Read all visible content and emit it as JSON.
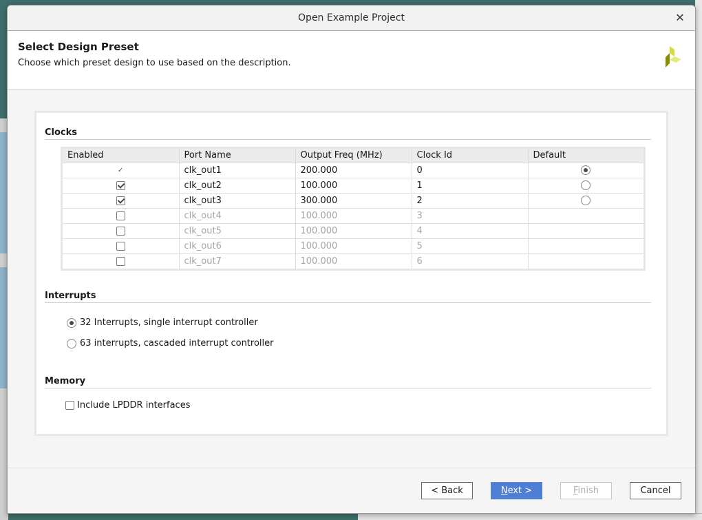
{
  "window": {
    "title": "Open Example Project"
  },
  "header": {
    "title": "Select Design Preset",
    "subtitle": "Choose which preset design to use based on the description."
  },
  "clocks": {
    "section_label": "Clocks",
    "columns": [
      "Enabled",
      "Port Name",
      "Output Freq (MHz)",
      "Clock Id",
      "Default"
    ],
    "rows": [
      {
        "enabled": "locked-checked",
        "port": "clk_out1",
        "freq": "200.000",
        "id": "0",
        "default": "selected",
        "active": true
      },
      {
        "enabled": "checked",
        "port": "clk_out2",
        "freq": "100.000",
        "id": "1",
        "default": "unselected",
        "active": true
      },
      {
        "enabled": "checked",
        "port": "clk_out3",
        "freq": "300.000",
        "id": "2",
        "default": "unselected",
        "active": true
      },
      {
        "enabled": "unchecked",
        "port": "clk_out4",
        "freq": "100.000",
        "id": "3",
        "default": "none",
        "active": false
      },
      {
        "enabled": "unchecked",
        "port": "clk_out5",
        "freq": "100.000",
        "id": "4",
        "default": "none",
        "active": false
      },
      {
        "enabled": "unchecked",
        "port": "clk_out6",
        "freq": "100.000",
        "id": "5",
        "default": "none",
        "active": false
      },
      {
        "enabled": "unchecked",
        "port": "clk_out7",
        "freq": "100.000",
        "id": "6",
        "default": "none",
        "active": false
      }
    ]
  },
  "interrupts": {
    "section_label": "Interrupts",
    "options": [
      {
        "label": "32 Interrupts, single interrupt controller",
        "selected": true
      },
      {
        "label": "63 interrupts, cascaded interrupt controller",
        "selected": false
      }
    ]
  },
  "memory": {
    "section_label": "Memory",
    "include_lpddr": {
      "label": "Include LPDDR interfaces",
      "checked": false
    }
  },
  "buttons": {
    "back": "< Back",
    "next_mnemonic": "N",
    "next_rest": "ext >",
    "finish_mnemonic": "F",
    "finish_rest": "inish",
    "cancel": "Cancel"
  },
  "colors": {
    "primary_button": "#4f7fd2",
    "logo_light": "#e0ec7a",
    "logo_mid": "#d4dc3a",
    "logo_dark": "#8a8c00"
  }
}
